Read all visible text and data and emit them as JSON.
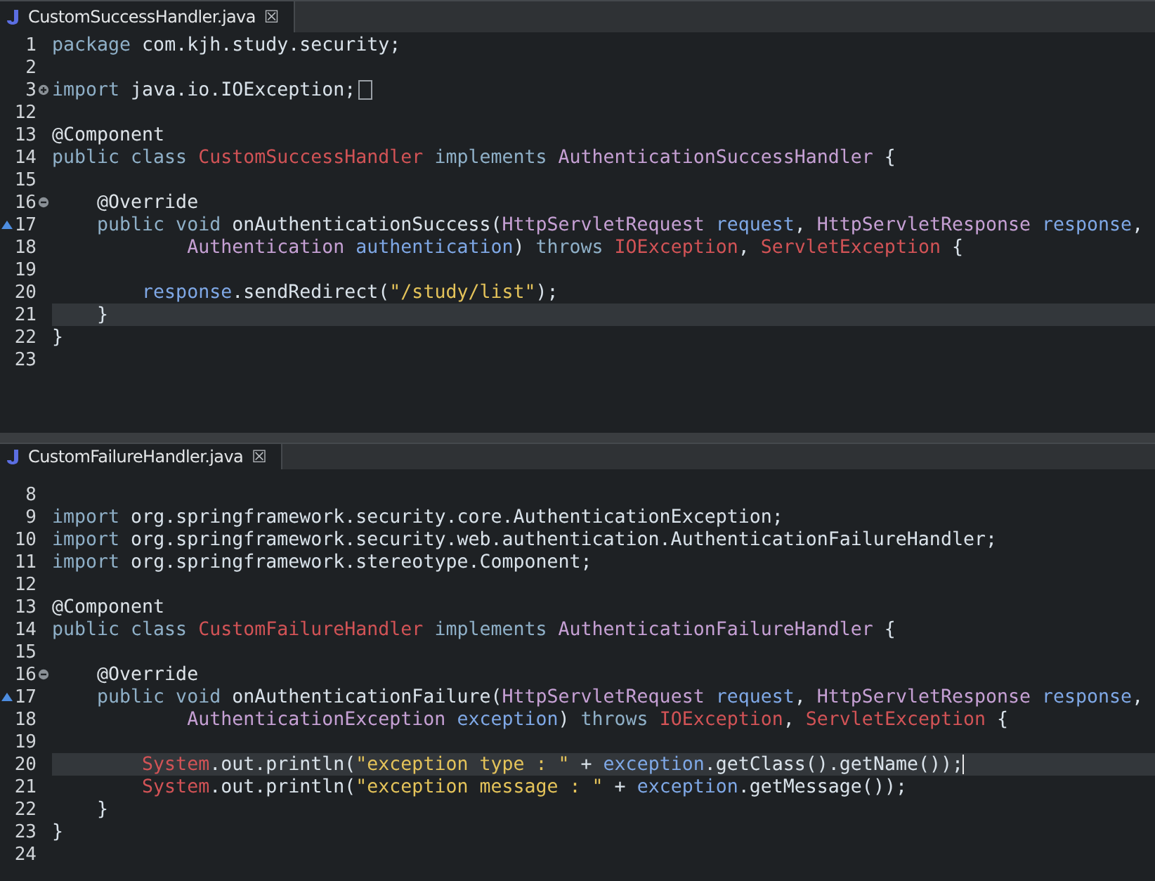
{
  "editors": [
    {
      "tab": {
        "title": "CustomSuccessHandler.java",
        "close": "☒"
      },
      "lines": [
        {
          "number": "1",
          "kind": "plain",
          "current": false,
          "tokens": [
            {
              "kind": "keyword",
              "text": "package"
            },
            {
              "kind": "plain",
              "text": " com.kjh.study.security;"
            }
          ]
        },
        {
          "number": "2",
          "kind": "plain",
          "current": false
        },
        {
          "number": "3",
          "kind": "fold-collapsed",
          "current": false,
          "tokens": [
            {
              "kind": "keyword",
              "text": "import"
            },
            {
              "kind": "plain",
              "text": " java.io.IOException;"
            }
          ]
        },
        {
          "number": "12",
          "kind": "plain",
          "current": false
        },
        {
          "number": "13",
          "kind": "plain",
          "current": false,
          "tokens": [
            {
              "kind": "annotation",
              "text": "@Component"
            }
          ]
        },
        {
          "number": "14",
          "kind": "plain",
          "current": false,
          "tokens": [
            {
              "kind": "keyword",
              "text": "public class "
            },
            {
              "kind": "class",
              "text": "CustomSuccessHandler"
            },
            {
              "kind": "keyword",
              "text": " implements "
            },
            {
              "kind": "interface",
              "text": "AuthenticationSuccessHandler"
            },
            {
              "kind": "plain",
              "text": " {"
            }
          ]
        },
        {
          "number": "15",
          "kind": "plain",
          "current": false
        },
        {
          "number": "16",
          "kind": "fold-expanded",
          "current": false,
          "tokens": [
            {
              "kind": "annotation",
              "text": "    @Override"
            }
          ]
        },
        {
          "number": "17",
          "kind": "override",
          "current": false,
          "tokens": [
            {
              "kind": "keyword",
              "text": "    public void "
            },
            {
              "kind": "plain",
              "text": "onAuthenticationSuccess("
            },
            {
              "kind": "interface",
              "text": "HttpServletRequest"
            },
            {
              "kind": "variable",
              "text": " request"
            },
            {
              "kind": "plain",
              "text": ", "
            },
            {
              "kind": "interface",
              "text": "HttpServletResponse"
            },
            {
              "kind": "variable",
              "text": " response"
            },
            {
              "kind": "plain",
              "text": ","
            }
          ]
        },
        {
          "number": "18",
          "kind": "plain",
          "current": false,
          "tokens": [
            {
              "kind": "interface",
              "text": "            Authentication"
            },
            {
              "kind": "variable",
              "text": " authentication"
            },
            {
              "kind": "plain",
              "text": ") "
            },
            {
              "kind": "keyword",
              "text": "throws "
            },
            {
              "kind": "class",
              "text": "IOException"
            },
            {
              "kind": "plain",
              "text": ", "
            },
            {
              "kind": "class",
              "text": "ServletException"
            },
            {
              "kind": "plain",
              "text": " {"
            }
          ]
        },
        {
          "number": "19",
          "kind": "plain",
          "current": false
        },
        {
          "number": "20",
          "kind": "plain",
          "current": false,
          "tokens": [
            {
              "kind": "variable",
              "text": "        response"
            },
            {
              "kind": "plain",
              "text": ".sendRedirect("
            },
            {
              "kind": "string",
              "text": "\"/study/list\""
            },
            {
              "kind": "plain",
              "text": ");"
            }
          ]
        },
        {
          "number": "21",
          "kind": "plain",
          "current": true,
          "tokens": [
            {
              "kind": "plain",
              "text": "    }"
            }
          ]
        },
        {
          "number": "22",
          "kind": "plain",
          "current": false,
          "tokens": [
            {
              "kind": "plain",
              "text": "}"
            }
          ]
        },
        {
          "number": "23",
          "kind": "plain",
          "current": false
        }
      ]
    },
    {
      "tab": {
        "title": "CustomFailureHandler.java",
        "close": "☒"
      },
      "lines": [
        {
          "number": "8",
          "kind": "plain",
          "current": false
        },
        {
          "number": "9",
          "kind": "plain",
          "current": false,
          "tokens": [
            {
              "kind": "keyword",
              "text": "import"
            },
            {
              "kind": "plain",
              "text": " org.springframework.security.core.AuthenticationException;"
            }
          ]
        },
        {
          "number": "10",
          "kind": "plain",
          "current": false,
          "tokens": [
            {
              "kind": "keyword",
              "text": "import"
            },
            {
              "kind": "plain",
              "text": " org.springframework.security.web.authentication.AuthenticationFailureHandler;"
            }
          ]
        },
        {
          "number": "11",
          "kind": "plain",
          "current": false,
          "tokens": [
            {
              "kind": "keyword",
              "text": "import"
            },
            {
              "kind": "plain",
              "text": " org.springframework.stereotype.Component;"
            }
          ]
        },
        {
          "number": "12",
          "kind": "plain",
          "current": false
        },
        {
          "number": "13",
          "kind": "plain",
          "current": false,
          "tokens": [
            {
              "kind": "annotation",
              "text": "@Component"
            }
          ]
        },
        {
          "number": "14",
          "kind": "plain",
          "current": false,
          "tokens": [
            {
              "kind": "keyword",
              "text": "public class "
            },
            {
              "kind": "class",
              "text": "CustomFailureHandler"
            },
            {
              "kind": "keyword",
              "text": " implements "
            },
            {
              "kind": "interface",
              "text": "AuthenticationFailureHandler"
            },
            {
              "kind": "plain",
              "text": " {"
            }
          ]
        },
        {
          "number": "15",
          "kind": "plain",
          "current": false
        },
        {
          "number": "16",
          "kind": "fold-expanded",
          "current": false,
          "tokens": [
            {
              "kind": "annotation",
              "text": "    @Override"
            }
          ]
        },
        {
          "number": "17",
          "kind": "override",
          "current": false,
          "tokens": [
            {
              "kind": "keyword",
              "text": "    public void "
            },
            {
              "kind": "plain",
              "text": "onAuthenticationFailure("
            },
            {
              "kind": "interface",
              "text": "HttpServletRequest"
            },
            {
              "kind": "variable",
              "text": " request"
            },
            {
              "kind": "plain",
              "text": ", "
            },
            {
              "kind": "interface",
              "text": "HttpServletResponse"
            },
            {
              "kind": "variable",
              "text": " response"
            },
            {
              "kind": "plain",
              "text": ","
            }
          ]
        },
        {
          "number": "18",
          "kind": "plain",
          "current": false,
          "tokens": [
            {
              "kind": "interface",
              "text": "            AuthenticationException"
            },
            {
              "kind": "variable",
              "text": " exception"
            },
            {
              "kind": "plain",
              "text": ") "
            },
            {
              "kind": "keyword",
              "text": "throws "
            },
            {
              "kind": "class",
              "text": "IOException"
            },
            {
              "kind": "plain",
              "text": ", "
            },
            {
              "kind": "class",
              "text": "ServletException"
            },
            {
              "kind": "plain",
              "text": " {"
            }
          ]
        },
        {
          "number": "19",
          "kind": "plain",
          "current": false
        },
        {
          "number": "20",
          "kind": "plain",
          "current": true,
          "caret": true,
          "tokens": [
            {
              "kind": "class",
              "text": "        System"
            },
            {
              "kind": "plain",
              "text": ".out.println("
            },
            {
              "kind": "string",
              "text": "\"exception type : \""
            },
            {
              "kind": "plain",
              "text": " + "
            },
            {
              "kind": "variable",
              "text": "exception"
            },
            {
              "kind": "plain",
              "text": ".getClass().getName());"
            }
          ]
        },
        {
          "number": "21",
          "kind": "plain",
          "current": false,
          "tokens": [
            {
              "kind": "class",
              "text": "        System"
            },
            {
              "kind": "plain",
              "text": ".out.println("
            },
            {
              "kind": "string",
              "text": "\"exception message : \""
            },
            {
              "kind": "plain",
              "text": " + "
            },
            {
              "kind": "variable",
              "text": "exception"
            },
            {
              "kind": "plain",
              "text": ".getMessage());"
            }
          ]
        },
        {
          "number": "22",
          "kind": "plain",
          "current": false,
          "tokens": [
            {
              "kind": "plain",
              "text": "    }"
            }
          ]
        },
        {
          "number": "23",
          "kind": "plain",
          "current": false,
          "tokens": [
            {
              "kind": "plain",
              "text": "}"
            }
          ]
        },
        {
          "number": "24",
          "kind": "plain",
          "current": false
        }
      ]
    }
  ]
}
